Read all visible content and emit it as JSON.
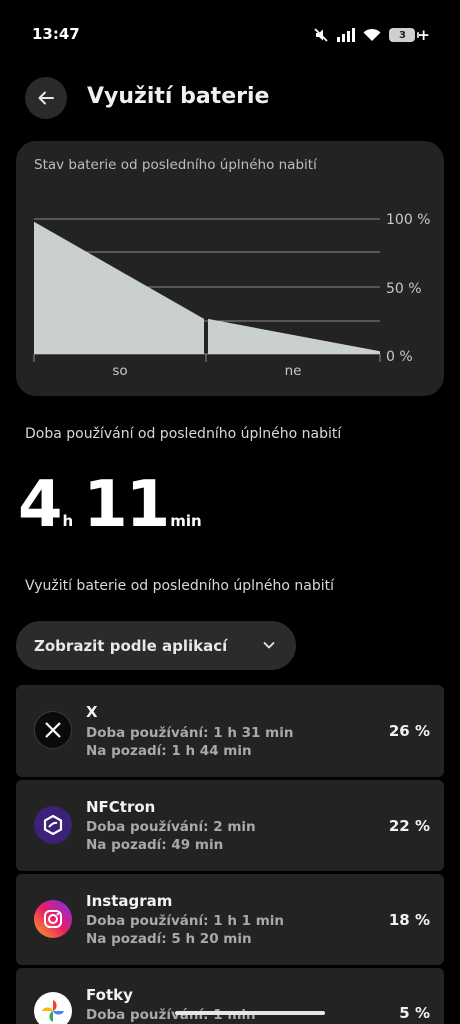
{
  "status_bar": {
    "time": "13:47",
    "battery_level": "3",
    "icons": [
      "mute-icon",
      "signal-icon",
      "wifi-icon",
      "battery-icon"
    ]
  },
  "header": {
    "title": "Využití baterie",
    "back_icon": "arrow-left-icon"
  },
  "chart": {
    "caption": "Stav baterie od posledního úplného nabití",
    "y_ticks": [
      "100 %",
      "50 %",
      "0 %"
    ],
    "x_labels": [
      "so",
      "ne"
    ]
  },
  "chart_data": {
    "type": "area",
    "title": "Stav baterie od posledního úplného nabití",
    "x": [
      "so",
      "ne"
    ],
    "ylim": [
      0,
      100
    ],
    "y_ticks": [
      "100 %",
      "50 %",
      "0 %"
    ],
    "series": [
      {
        "values": [
          98,
          26,
          26,
          2
        ]
      }
    ],
    "grid": true,
    "fill_color": "#c9d0cf"
  },
  "usage": {
    "label": "Doba používání od posledního úplného nabití",
    "hours": "4",
    "hours_unit": "h",
    "minutes": "11",
    "minutes_unit": "min"
  },
  "section": {
    "label": "Využití baterie od posledního úplného nabití"
  },
  "dropdown": {
    "label": "Zobrazit podle aplikací",
    "icon": "chevron-down-icon"
  },
  "apps": [
    {
      "name": "X",
      "line1": "Doba používání: 1 h 31 min",
      "line2": "Na pozadí: 1 h 44 min",
      "percent": "26 %",
      "icon": "x-app-icon"
    },
    {
      "name": "NFCtron",
      "line1": "Doba používání: 2 min",
      "line2": "Na pozadí: 49 min",
      "percent": "22 %",
      "icon": "nfctron-app-icon"
    },
    {
      "name": "Instagram",
      "line1": "Doba používání: 1 h 1 min",
      "line2": "Na pozadí: 5 h 20 min",
      "percent": "18 %",
      "icon": "instagram-app-icon"
    },
    {
      "name": "Fotky",
      "line1": "Doba používání: 1 min",
      "line2": "",
      "percent": "5 %",
      "icon": "photos-app-icon"
    }
  ]
}
